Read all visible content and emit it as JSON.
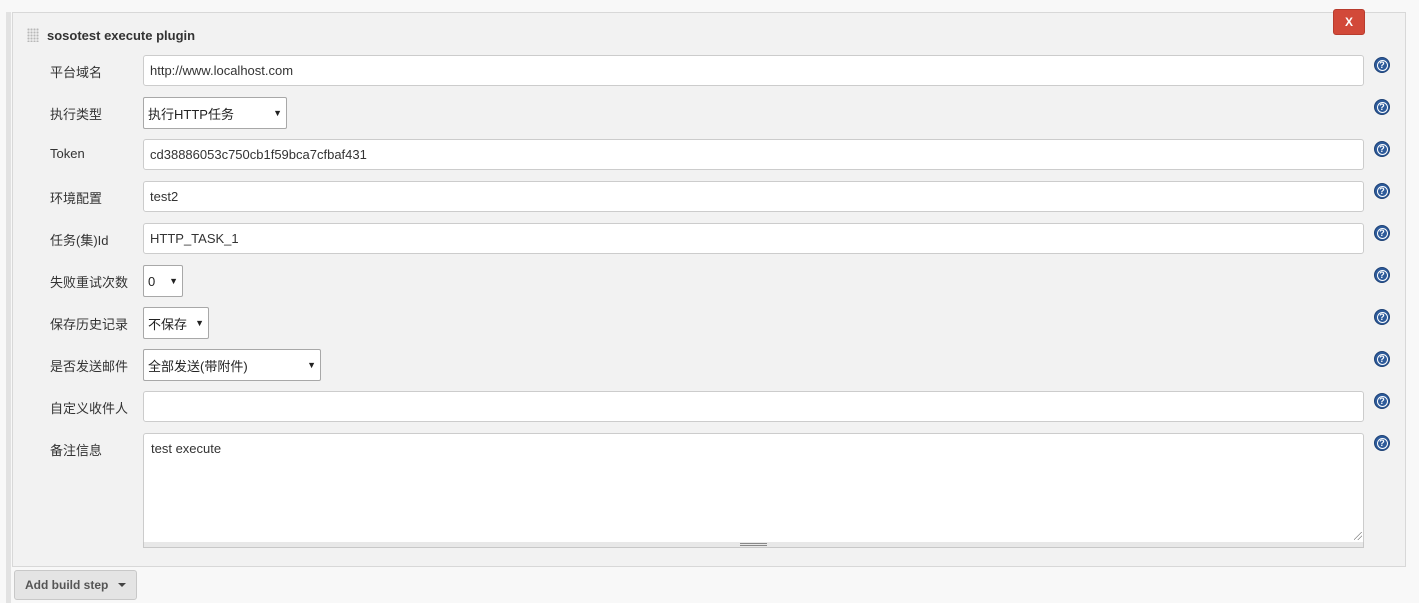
{
  "step": {
    "title": "sosotest execute plugin",
    "delete_label": "X"
  },
  "fields": [
    {
      "label": "平台域名",
      "type": "text",
      "value": "http://www.localhost.com"
    },
    {
      "label": "执行类型",
      "type": "select",
      "value": "执行HTTP任务"
    },
    {
      "label": "Token",
      "type": "text",
      "value": "cd38886053c750cb1f59bca7cfbaf431"
    },
    {
      "label": "环境配置",
      "type": "text",
      "value": "test2"
    },
    {
      "label": "任务(集)Id",
      "type": "text",
      "value": "HTTP_TASK_1"
    },
    {
      "label": "失败重试次数",
      "type": "select",
      "value": "0"
    },
    {
      "label": "保存历史记录",
      "type": "select",
      "value": "不保存"
    },
    {
      "label": "是否发送邮件",
      "type": "select",
      "value": "全部发送(带附件)"
    },
    {
      "label": "自定义收件人",
      "type": "text",
      "value": ""
    },
    {
      "label": "备注信息",
      "type": "textarea",
      "value": "test execute"
    }
  ],
  "icons": {
    "help": "question-circle-icon",
    "dropdown": "▼"
  },
  "help_glyph": "?",
  "footer": {
    "add_build_step_label": "Add build step"
  },
  "colors": {
    "delete_button": "#d24939",
    "help_icon": "#2e5b9a",
    "panel_bg": "#f2f2f2"
  }
}
